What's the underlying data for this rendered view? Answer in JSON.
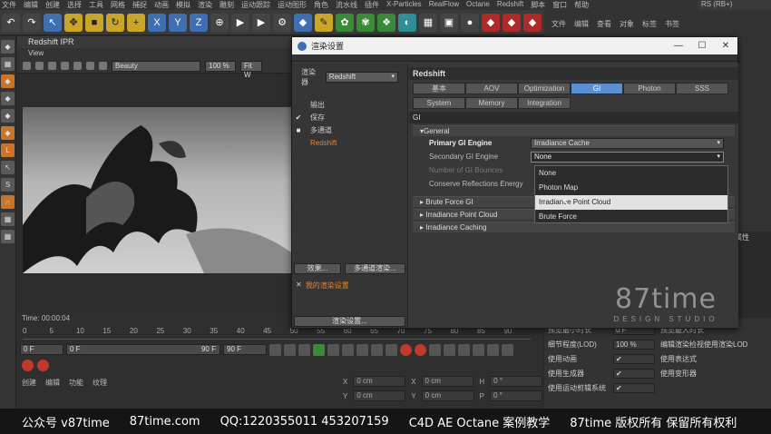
{
  "app": {
    "menubar": [
      "文件",
      "编辑",
      "创建",
      "选择",
      "工具",
      "网格",
      "捕捉",
      "动画",
      "模拟",
      "渲染",
      "雕刻",
      "运动跟踪",
      "运动图形",
      "角色",
      "流水线",
      "插件",
      "X-Particles",
      "RealFlow",
      "Octane",
      "Redshift",
      "脚本",
      "窗口",
      "帮助"
    ],
    "right_tag": "RS (RB+)",
    "right_menu": [
      "文件",
      "编辑",
      "查看",
      "对象",
      "标签",
      "书签"
    ]
  },
  "ipr": {
    "title": "Redshift IPR",
    "menu": "View",
    "beauty": "Beauty",
    "zoom": "100 %",
    "fit": "Fit W"
  },
  "timeline": {
    "time": "Time: 00:00:04",
    "ticks": [
      "0",
      "5",
      "10",
      "15",
      "20",
      "25",
      "30",
      "35",
      "40",
      "45",
      "50",
      "55",
      "60",
      "65",
      "70",
      "75",
      "80",
      "85",
      "90"
    ],
    "start": "0 F",
    "start2": "0 F",
    "end": "90 F",
    "end2": "90 F"
  },
  "material_menu": [
    "创建",
    "编辑",
    "功能",
    "纹理"
  ],
  "coords": {
    "rows": [
      {
        "a": "X",
        "av": "0 cm",
        "b": "X",
        "bv": "0 cm",
        "c": "H",
        "cv": "0 °"
      },
      {
        "a": "Y",
        "av": "0 cm",
        "b": "Y",
        "bv": "0 cm",
        "c": "P",
        "cv": "0 °"
      }
    ]
  },
  "props": [
    {
      "label": "预览最小时长",
      "value": "0 F",
      "label2": "预览最大时长"
    },
    {
      "label": "细节程度(LOD)",
      "value": "100 %",
      "label2": "编辑渲染检视使用渲染LOD"
    },
    {
      "label": "使用动画",
      "value": "✔",
      "label2": "使用表达式"
    },
    {
      "label": "使用生成器",
      "value": "✔",
      "label2": "使用变形器"
    },
    {
      "label": "使用运动剪辑系统",
      "value": "✔",
      "label2": ""
    }
  ],
  "side_tag": "属性",
  "dialog": {
    "title": "渲染设置",
    "renderer_label": "渲染器",
    "renderer": "Redshift",
    "tree": [
      {
        "check": "",
        "label": "输出",
        "active": false
      },
      {
        "check": "✔",
        "label": "保存",
        "active": false
      },
      {
        "check": "■",
        "label": "多通道",
        "active": false
      },
      {
        "check": "",
        "label": "Redshift",
        "active": true
      }
    ],
    "effects_btn": "效果...",
    "multipass_btn": "多通道渲染...",
    "my_settings": "我的渲染设置",
    "render_settings_btn": "渲染设置...",
    "header": "Redshift",
    "tabs_row1": [
      "基本",
      "AOV",
      "Optimization",
      "GI",
      "Photon",
      "SSS"
    ],
    "tabs_row2": [
      "System",
      "Memory",
      "Integration"
    ],
    "active_tab": "GI",
    "section": "GI",
    "general": "General",
    "primary_label": "Primary GI Engine",
    "primary_value": "Irradiance Cache",
    "secondary_label": "Secondary GI Engine",
    "secondary_value": "None",
    "bounces_label": "Number of GI Bounces",
    "reflections_label": "Conserve Reflections Energy",
    "options": [
      "None",
      "Photon Map",
      "Irradiance Point Cloud",
      "Brute Force"
    ],
    "highlighted_option": "Irradiance Point Cloud",
    "groups": [
      "Brute Force GI",
      "Irradiance Point Cloud",
      "Irradiance Caching"
    ]
  },
  "watermark": {
    "big": "87time",
    "small": "DESIGN STUDIO"
  },
  "banner": [
    "公众号 v87time",
    "87time.com",
    "QQ:1220355011   453207159",
    "C4D AE Octane 案例教学",
    "87time 版权所有  保留所有权利"
  ]
}
